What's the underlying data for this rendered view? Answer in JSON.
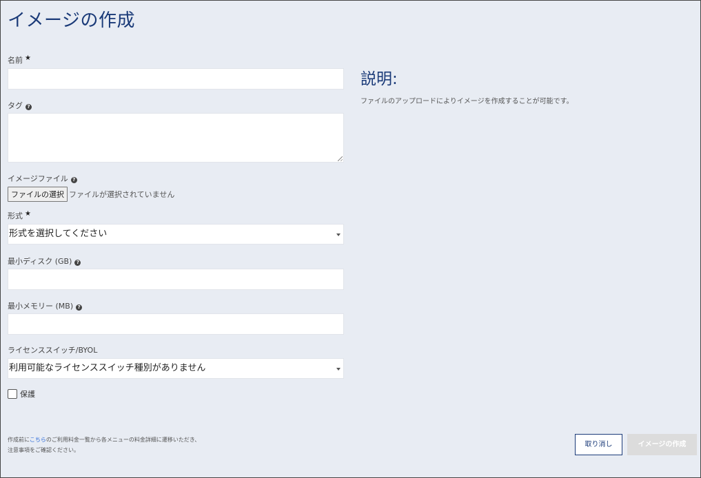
{
  "page": {
    "title": "イメージの作成"
  },
  "form": {
    "name": {
      "label": "名前",
      "required_mark": "★",
      "value": ""
    },
    "tags": {
      "label": "タグ",
      "help_icon": "question-circle-icon",
      "value": ""
    },
    "image_file": {
      "label": "イメージファイル",
      "help_icon": "question-circle-icon",
      "button_label": "ファイルの選択",
      "status": "ファイルが選択されていません"
    },
    "format": {
      "label": "形式",
      "required_mark": "★",
      "selected": "形式を選択してください"
    },
    "min_disk": {
      "label": "最小ディスク (GB)",
      "help_icon": "question-circle-icon",
      "value": ""
    },
    "min_memory": {
      "label": "最小メモリー (MB)",
      "help_icon": "question-circle-icon",
      "value": ""
    },
    "license_switch": {
      "label": "ライセンススイッチ/BYOL",
      "selected": "利用可能なライセンススイッチ種別がありません"
    },
    "protect": {
      "label": "保護",
      "checked": false
    }
  },
  "description": {
    "title": "説明:",
    "text": "ファイルのアップロードによりイメージを作成することが可能です。"
  },
  "notice": {
    "prefix": "作成前に",
    "link": "こちら",
    "suffix": "のご利用料金一覧から各メニューの料金詳細に遷移いただき、",
    "line2": "注意事項をご確認ください。"
  },
  "buttons": {
    "cancel": "取り消し",
    "create": "イメージの作成"
  },
  "colors": {
    "accent": "#1a3a78",
    "background": "#e8ecf3",
    "link": "#2e6bd8",
    "disabled_button": "#dcdcdc"
  }
}
